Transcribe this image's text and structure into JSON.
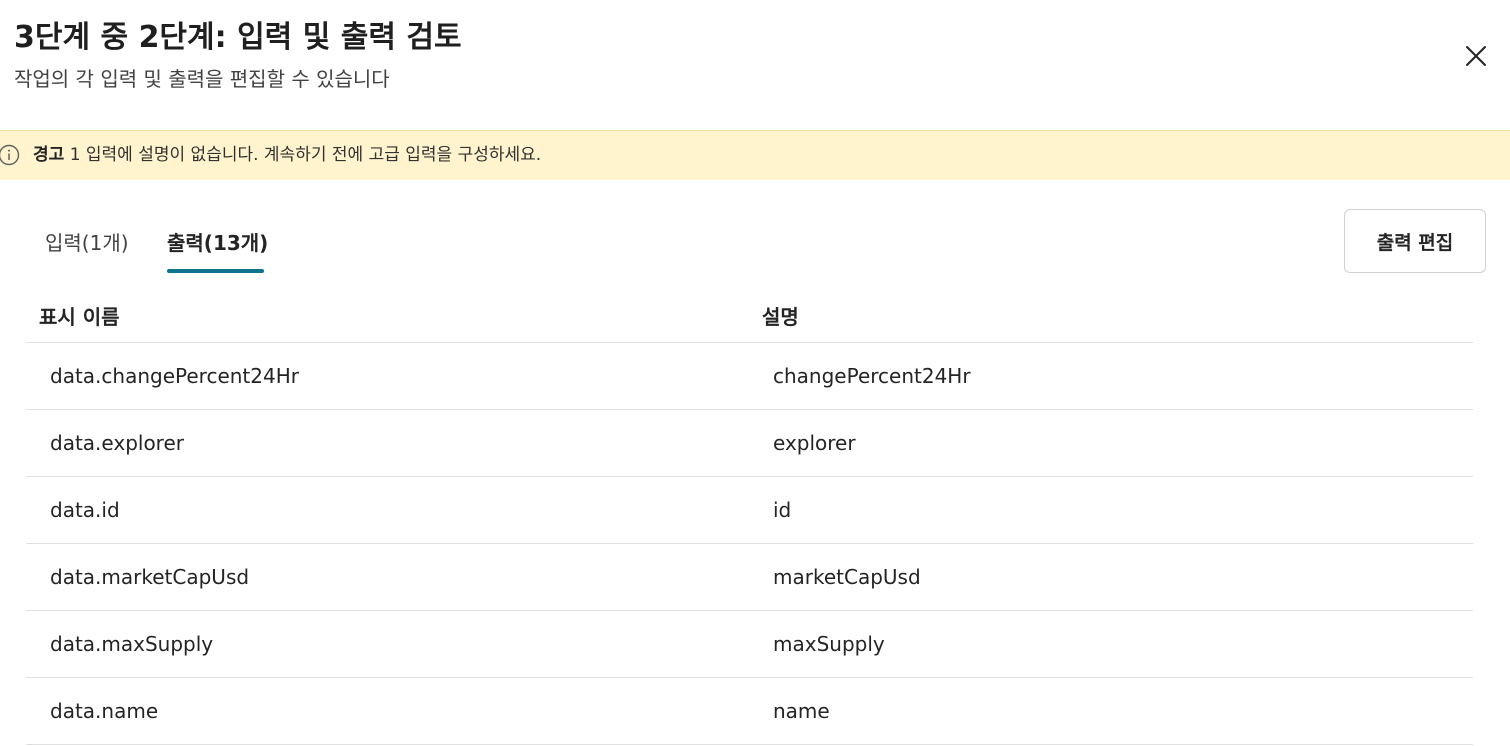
{
  "header": {
    "title": "3단계 중 2단계: 입력 및 출력 검토",
    "subtitle": "작업의 각 입력 및 출력을 편집할 수 있습니다",
    "close_icon": "close-icon"
  },
  "warning": {
    "icon": "info-icon",
    "label": "경고",
    "message": "1 입력에 설명이 없습니다. 계속하기 전에 고급 입력을 구성하세요.",
    "background": "#fff4ce"
  },
  "tabs": [
    {
      "label": "입력(1개)",
      "selected": false
    },
    {
      "label": "출력(13개)",
      "selected": true
    }
  ],
  "actions": {
    "edit_outputs_label": "출력 편집"
  },
  "table": {
    "columns": [
      "표시 이름",
      "설명"
    ],
    "rows": [
      {
        "name": "data.changePercent24Hr",
        "description": "changePercent24Hr"
      },
      {
        "name": "data.explorer",
        "description": "explorer"
      },
      {
        "name": "data.id",
        "description": "id"
      },
      {
        "name": "data.marketCapUsd",
        "description": "marketCapUsd"
      },
      {
        "name": "data.maxSupply",
        "description": "maxSupply"
      },
      {
        "name": "data.name",
        "description": "name"
      }
    ]
  },
  "colors": {
    "accent": "#0e7490",
    "divider": "#e0e0e0"
  }
}
